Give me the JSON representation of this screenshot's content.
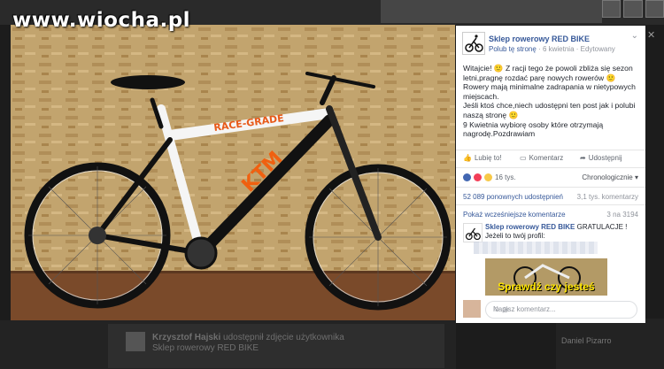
{
  "watermark": "www.wiocha.pl",
  "post": {
    "page_name": "Sklep rowerowy RED BIKE",
    "like_page": "Polub tę stronę",
    "date": "6 kwietnia",
    "edited": "Edytowany",
    "text_lines": [
      "Witajcie! 🙂 Z racji tego że powoli zbliża się sezon letni,pragnę rozdać parę nowych rowerów 🙂 Rowery mają minimalne zadrapania w nietypowych miejscach.",
      "Jeśli ktoś chce,niech udostępni ten post jak i polubi naszą stronę 🙂",
      "9 Kwietnia wybiorę osoby które otrzymają nagrodę.Pozdrawiam"
    ],
    "actions": {
      "like": "Lubię to!",
      "comment": "Komentarz",
      "share": "Udostępnij"
    },
    "reactions_count": "16 tys.",
    "sort_label": "Chronologicznie",
    "shares_count": "52 089 ponownych udostępnień",
    "comments_count": "3,1 tys. komentarzy",
    "earlier_comments": "Pokaż wcześniejsze komentarze",
    "earlier_count": "3 na 3194",
    "comment": {
      "author": "Sklep rowerowy RED BIKE",
      "text_after": "GRATULACJE !",
      "line2": "Jeżeli to twój profil:",
      "image_caption": "Sprawdź czy jesteś"
    },
    "compose_placeholder": "Napisz komentarz..."
  },
  "background": {
    "left_post_author": "Krzysztof Hajski",
    "left_post_text": "udostępnił zdjęcie użytkownika Sklep rowerowy RED BIKE",
    "right_name": "Daniel Pizarro"
  },
  "colors": {
    "link": "#365899",
    "page_bg": "#1c1c1c"
  }
}
